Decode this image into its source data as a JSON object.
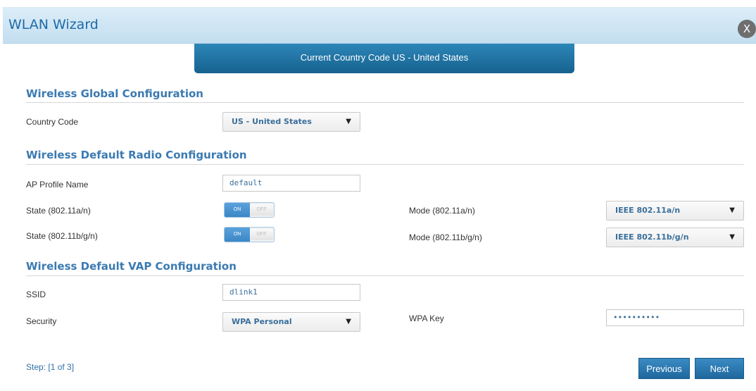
{
  "dialog": {
    "title": "WLAN Wizard",
    "close_label": "X",
    "banner": "Current Country Code US - United States"
  },
  "global": {
    "title": "Wireless Global Configuration",
    "country_code_label": "Country Code",
    "country_code_value": "US - United States"
  },
  "radio": {
    "title": "Wireless Default Radio Configuration",
    "ap_profile_label": "AP Profile Name",
    "ap_profile_value": "default",
    "state_a_label": "State (802.11a/n)",
    "state_bg_label": "State (802.11b/g/n)",
    "toggle_on": "ON",
    "toggle_off": "OFF",
    "mode_a_label": "Mode (802.11a/n)",
    "mode_a_value": "IEEE 802.11a/n",
    "mode_bg_label": "Mode (802.11b/g/n)",
    "mode_bg_value": "IEEE 802.11b/g/n"
  },
  "vap": {
    "title": "Wireless Default VAP Configuration",
    "ssid_label": "SSID",
    "ssid_value": "dlink1",
    "security_label": "Security",
    "security_value": "WPA Personal",
    "wpa_key_label": "WPA Key",
    "wpa_key_value": "••••••••••"
  },
  "footer": {
    "step": "Step: [1 of 3]",
    "previous": "Previous",
    "next": "Next"
  },
  "icons": {
    "dropdown": "▼"
  }
}
